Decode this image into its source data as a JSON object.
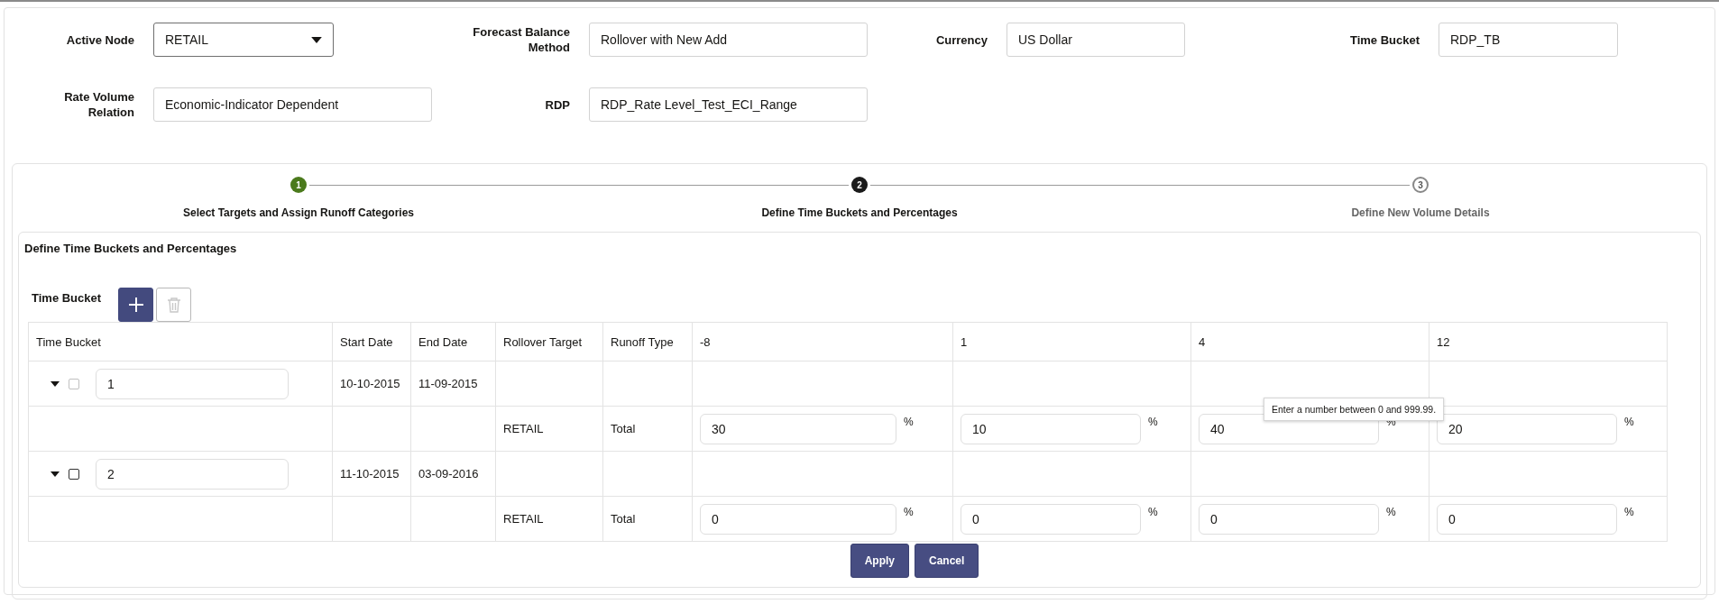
{
  "filters": [
    {
      "label": "Active Node",
      "kind": "select",
      "value": "RETAIL"
    },
    {
      "label": "Forecast Balance Method",
      "kind": "text",
      "value": "Rollover with New Add"
    },
    {
      "label": "Currency",
      "kind": "text",
      "value": "US Dollar"
    },
    {
      "label": "Time Bucket",
      "kind": "text",
      "value": "RDP_TB"
    },
    {
      "label": "Rate Volume Relation",
      "kind": "text",
      "value": "Economic-Indicator Dependent"
    },
    {
      "label": "RDP",
      "kind": "text",
      "value": "RDP_Rate Level_Test_ECI_Range"
    }
  ],
  "steps": [
    {
      "number": "1",
      "label": "Select Targets and Assign Runoff Categories",
      "completed": true,
      "selected": false
    },
    {
      "number": "2",
      "label": "Define Time Buckets and Percentages",
      "completed": false,
      "selected": true
    },
    {
      "number": "3",
      "label": "Define New Volume Details",
      "completed": false,
      "selected": false
    }
  ],
  "panel": {
    "title": "Define Time Buckets and Percentages",
    "toolbar_label": "Time Bucket",
    "tools": [
      {
        "kind": "add",
        "disabled": false
      },
      {
        "kind": "delete",
        "disabled": true
      }
    ],
    "table": {
      "columns": [
        "Time Bucket",
        "Start Date",
        "End Date",
        "Rollover Target",
        "Runoff Type",
        "-8",
        "1",
        "4",
        "12"
      ],
      "rows": [
        {
          "kind": "bucket",
          "expanded": true,
          "checked": false,
          "disabled": true,
          "value": "1",
          "start": "10-10-2015",
          "end": "11-09-2015"
        },
        {
          "kind": "detail",
          "target": "RETAIL",
          "runoff": "Total",
          "percents": [
            {
              "value": "30",
              "unit": "%"
            },
            {
              "value": "10",
              "unit": "%"
            },
            {
              "value": "40",
              "unit": "%",
              "tooltip": "Enter a number between 0 and 999.99."
            },
            {
              "value": "20",
              "unit": "%"
            }
          ]
        },
        {
          "kind": "bucket",
          "expanded": true,
          "checked": false,
          "disabled": false,
          "value": "2",
          "start": "11-10-2015",
          "end": "03-09-2016"
        },
        {
          "kind": "detail",
          "target": "RETAIL",
          "runoff": "Total",
          "percents": [
            {
              "value": "0",
              "unit": "%"
            },
            {
              "value": "0",
              "unit": "%"
            },
            {
              "value": "0",
              "unit": "%"
            },
            {
              "value": "0",
              "unit": "%"
            }
          ]
        }
      ]
    },
    "actions": [
      "Apply",
      "Cancel"
    ]
  }
}
